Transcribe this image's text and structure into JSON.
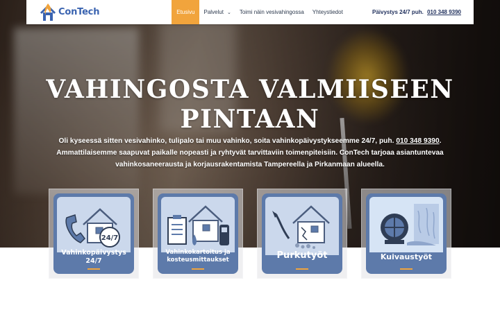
{
  "brand": {
    "name": "ConTech",
    "logo_icon": "house-flame-logo"
  },
  "nav": {
    "items": [
      {
        "label": "Etusivu",
        "active": true
      },
      {
        "label": "Palvelut",
        "has_dropdown": true
      },
      {
        "label": "Toimi näin vesivahingossa"
      },
      {
        "label": "Yhteystiedot"
      }
    ],
    "dropdown_icon": "chevron-down-icon"
  },
  "header": {
    "phone_prefix": "Päivystys 24/7 puh.",
    "phone_number": "010 348 9390"
  },
  "hero": {
    "title_line1": "VAHINGOSTA VALMIISEEN",
    "title_line2": "PINTAAN",
    "text_part1": "Oli kyseessä sitten vesivahinko, tulipalo tai muu vahinko, soita vahinkopäivystykseemme 24/7, puh.",
    "text_phone": "010 348 9390",
    "text_part2": ". Ammattilaisemme saapuvat paikalle nopeasti ja ryhtyvät tarvittaviin toimenpiteisiin. ConTech tarjoaa asiantuntevaa vahinkosaneerausta ja korjausrakentamista Tampereella ja Pirkanmaan alueella."
  },
  "services": [
    {
      "line1": "Vahinkopäivystys",
      "line2": "24/7",
      "icon": "phone-house-24-7-icon"
    },
    {
      "line1": "Vahinkokartoitus ja",
      "line2": "kosteusmittaukset",
      "icon": "clipboard-moisture-meter-icon"
    },
    {
      "line1": "Purkutyöt",
      "line2": "",
      "icon": "demolition-house-icon"
    },
    {
      "line1": "Kuivaustyöt",
      "line2": "",
      "icon": "drying-fan-icon"
    }
  ],
  "colors": {
    "accent": "#f1a43c",
    "brand_blue": "#3a63b0",
    "card_blue": "#5d7aaa"
  }
}
